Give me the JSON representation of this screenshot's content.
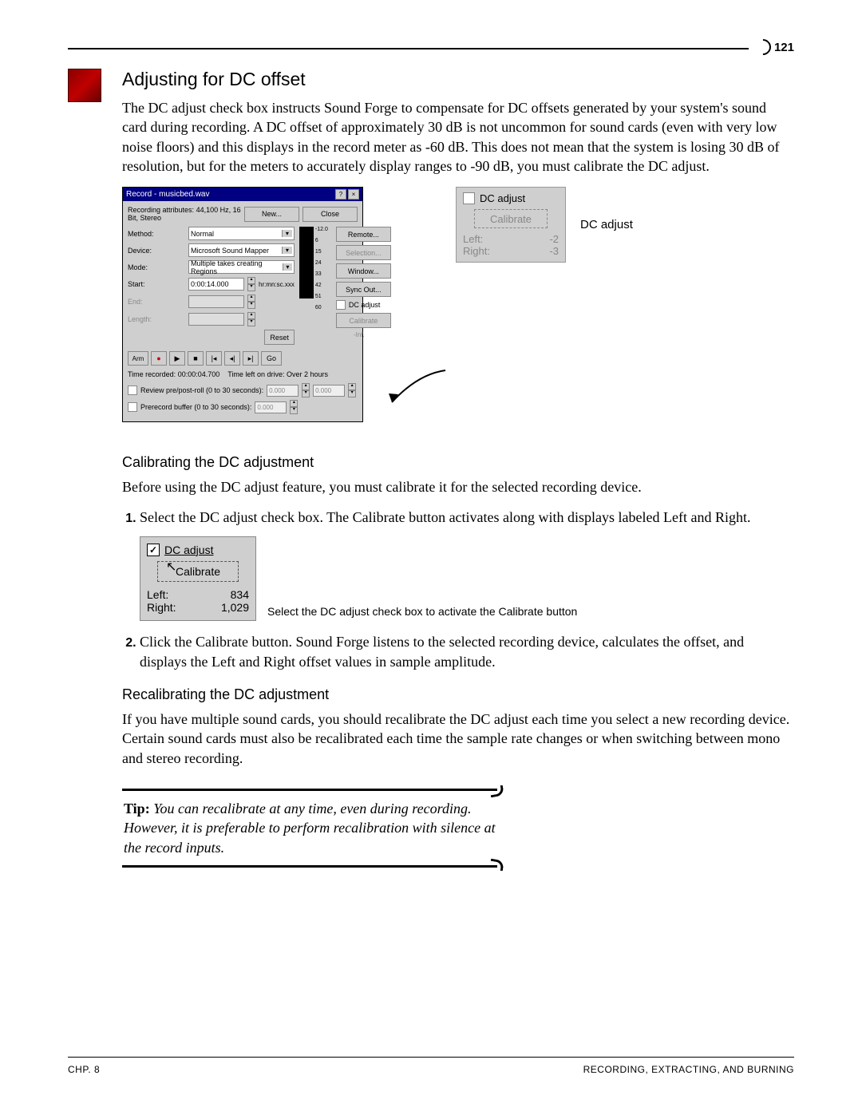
{
  "page_number": "121",
  "section_title": "Adjusting for DC offset",
  "intro_paragraph": "The DC adjust check box instructs Sound Forge to compensate for DC offsets generated by your system's sound card during recording. A DC offset of approximately 30 dB is not uncommon for sound cards (even with very low noise floors) and this displays in the record meter as -60 dB. This does not mean that the system is losing 30 dB of resolution, but for the meters to accurately display ranges to -90 dB, you must calibrate the DC adjust.",
  "record_dialog": {
    "title": "Record - musicbed.wav",
    "attrs_label": "Recording attributes:",
    "attrs_value": "44,100 Hz, 16 Bit, Stereo",
    "btn_new": "New...",
    "btn_close": "Close",
    "method_label": "Method:",
    "method_value": "Normal",
    "btn_remote": "Remote...",
    "device_label": "Device:",
    "device_value": "Microsoft Sound Mapper",
    "btn_selection": "Selection...",
    "mode_label": "Mode:",
    "mode_value": "Multiple takes creating Regions",
    "btn_window": "Window...",
    "start_label": "Start:",
    "start_value": "0:00:14.000",
    "start_units": "hr:mn:sc.xxx",
    "btn_syncout": "Sync Out...",
    "end_label": "End:",
    "length_label": "Length:",
    "dc_adjust_label": "DC adjust",
    "btn_calibrate": "Calibrate",
    "btn_reset": "Reset",
    "meter_peak": "-Inf.",
    "meter_ticks": [
      "-12.0",
      "6",
      "15",
      "24",
      "33",
      "42",
      "51",
      "60"
    ],
    "arm_label": "Arm",
    "go_label": "Go",
    "time_recorded_label": "Time recorded:",
    "time_recorded_value": "00:00:04.700",
    "time_left_label": "Time left on drive:",
    "time_left_value": "Over 2 hours",
    "review_label": "Review pre/post-roll (0 to 30 seconds):",
    "review_val1": "0.000",
    "review_val2": "0.000",
    "prerecord_label": "Prerecord buffer (0 to 30 seconds):",
    "prerecord_val": "0.000"
  },
  "dc_panel_large": {
    "cb_label": "DC adjust",
    "calibrate": "Calibrate",
    "left_label": "Left:",
    "left_val": "-2",
    "right_label": "Right:",
    "right_val": "-3"
  },
  "callout_label": "DC adjust",
  "sub1_heading": "Calibrating the DC adjustment",
  "sub1_text": "Before using the DC adjust feature, you must calibrate it for the selected recording device.",
  "step1": "Select the DC adjust check box. The Calibrate button activates along with displays labeled Left and Right.",
  "dc_panel_small": {
    "cb_label": "DC adjust",
    "calibrate": "Calibrate",
    "left_label": "Left:",
    "left_val": "834",
    "right_label": "Right:",
    "right_val": "1,029"
  },
  "fig2_caption": "Select the DC adjust check box to activate the Calibrate button",
  "step2": "Click the Calibrate button. Sound Forge listens to the selected recording device, calculates the offset, and displays the Left and Right offset values in sample amplitude.",
  "sub2_heading": "Recalibrating the DC adjustment",
  "sub2_text": "If you have multiple sound cards, you should recalibrate the DC adjust each time you select a new recording device. Certain sound cards must also be recalibrated each time the sample rate changes or when switching between mono and stereo recording.",
  "tip_label": "Tip:",
  "tip_body": "You can recalibrate at any time, even during recording. However, it is preferable to perform recalibration with silence at the record inputs.",
  "footer_left": "CHP. 8",
  "footer_right": "RECORDING, EXTRACTING, AND BURNING"
}
